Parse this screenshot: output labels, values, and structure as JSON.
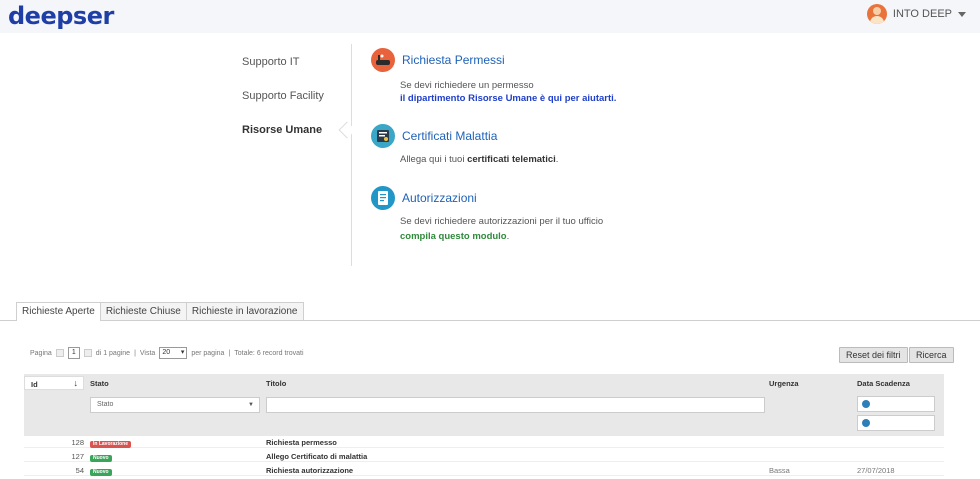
{
  "header": {
    "logo": "deepser",
    "user_name": "INTO DEEP"
  },
  "categories": [
    {
      "label": "Supporto IT",
      "active": false
    },
    {
      "label": "Supporto Facility",
      "active": false
    },
    {
      "label": "Risorse Umane",
      "active": true
    }
  ],
  "services": [
    {
      "icon": "bathtub-icon",
      "title": "Richiesta Permessi",
      "line1": "Se devi richiedere un permesso",
      "line2": "il dipartimento Risorse Umane è qui per aiutarti."
    },
    {
      "icon": "certificate-icon",
      "title": "Certificati Malattia",
      "line1_pre": "Allega qui i tuoi ",
      "line1_bold": "certificati telematici",
      "line1_post": "."
    },
    {
      "icon": "document-icon",
      "title": "Autorizzazioni",
      "line1": "Se devi richiedere autorizzazioni per il tuo ufficio",
      "line2_link": "compila questo modulo",
      "line2_post": "."
    }
  ],
  "tabs": [
    {
      "label": "Richieste Aperte",
      "active": true
    },
    {
      "label": "Richieste Chiuse",
      "active": false
    },
    {
      "label": "Richieste in lavorazione",
      "active": false
    }
  ],
  "pager": {
    "page_label": "Pagina",
    "page_value": "1",
    "of_pages": "di 1 pagine",
    "view_label": "Vista",
    "per_page_value": "20",
    "per_page_label": "per pagina",
    "total": "Totale: 6 record trovati",
    "separator": "|"
  },
  "buttons": {
    "reset": "Reset dei filtri",
    "search": "Ricerca"
  },
  "grid": {
    "columns": {
      "id": "Id",
      "stato": "Stato",
      "titolo": "Titolo",
      "urgenza": "Urgenza",
      "scadenza": "Data Scadenza"
    },
    "stato_placeholder": "Stato",
    "rows": [
      {
        "id": "128",
        "stato": "In Lavorazione",
        "stato_color": "#d9534f",
        "titolo": "Richiesta permesso",
        "urgenza": "",
        "scadenza": ""
      },
      {
        "id": "127",
        "stato": "Nuovo",
        "stato_color": "#3aa55a",
        "titolo": "Allego Certificato di malattia",
        "urgenza": "",
        "scadenza": ""
      },
      {
        "id": "54",
        "stato": "Nuovo",
        "stato_color": "#3aa55a",
        "titolo": "Richiesta autorizzazione",
        "urgenza": "Bassa",
        "scadenza": "27/07/2018"
      }
    ]
  },
  "colors": {
    "brand": "#1f3fa6",
    "link_blue": "#1f3fc8",
    "link_green": "#2f8a3a"
  }
}
